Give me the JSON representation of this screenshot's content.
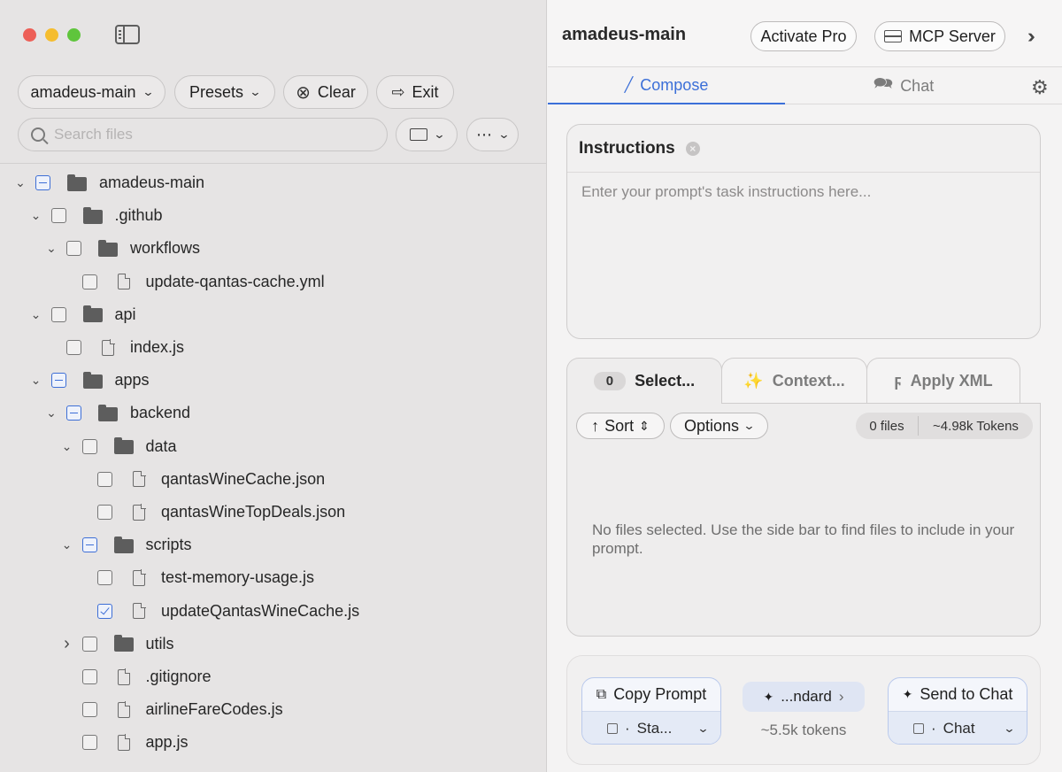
{
  "sidebar": {
    "project_select": "amadeus-main",
    "presets_label": "Presets",
    "clear_label": "Clear",
    "exit_label": "Exit",
    "search_placeholder": "Search files",
    "tree": [
      {
        "label": "amadeus-main",
        "type": "folder",
        "state": "mixed",
        "expand": "open"
      },
      {
        "label": ".github",
        "type": "folder",
        "state": "unchecked",
        "expand": "open"
      },
      {
        "label": "workflows",
        "type": "folder",
        "state": "unchecked",
        "expand": "open"
      },
      {
        "label": "update-qantas-cache.yml",
        "type": "file",
        "state": "unchecked",
        "expand": "none"
      },
      {
        "label": "api",
        "type": "folder",
        "state": "unchecked",
        "expand": "open"
      },
      {
        "label": "index.js",
        "type": "file",
        "state": "unchecked",
        "expand": "none"
      },
      {
        "label": "apps",
        "type": "folder",
        "state": "mixed",
        "expand": "open"
      },
      {
        "label": "backend",
        "type": "folder",
        "state": "mixed",
        "expand": "open"
      },
      {
        "label": "data",
        "type": "folder",
        "state": "unchecked",
        "expand": "open"
      },
      {
        "label": "qantasWineCache.json",
        "type": "file",
        "state": "unchecked",
        "expand": "none"
      },
      {
        "label": "qantasWineTopDeals.json",
        "type": "file",
        "state": "unchecked",
        "expand": "none"
      },
      {
        "label": "scripts",
        "type": "folder",
        "state": "mixed",
        "expand": "open"
      },
      {
        "label": "test-memory-usage.js",
        "type": "file",
        "state": "unchecked",
        "expand": "none"
      },
      {
        "label": "updateQantasWineCache.js",
        "type": "file",
        "state": "checked",
        "expand": "none"
      },
      {
        "label": "utils",
        "type": "folder",
        "state": "unchecked",
        "expand": "closed"
      },
      {
        "label": ".gitignore",
        "type": "file",
        "state": "unchecked",
        "expand": "none"
      },
      {
        "label": "airlineFareCodes.js",
        "type": "file",
        "state": "unchecked",
        "expand": "none"
      },
      {
        "label": "app.js",
        "type": "file",
        "state": "unchecked",
        "expand": "none"
      }
    ]
  },
  "header": {
    "title": "amadeus-main",
    "activate_label": "Activate Pro",
    "mcp_label": "MCP Server"
  },
  "tabs": {
    "compose": "Compose",
    "chat": "Chat"
  },
  "instructions": {
    "title": "Instructions",
    "placeholder": "Enter your prompt's task instructions here..."
  },
  "subtabs": {
    "selected_count": "0",
    "selected_label": "Select...",
    "context_label": "Context...",
    "apply_label": "Apply XML"
  },
  "files_panel": {
    "sort_label": "Sort",
    "options_label": "Options",
    "files_count": "0 files",
    "tokens": "~4.98k Tokens",
    "empty_message": "No files selected. Use the side bar to find files to include in your prompt."
  },
  "bottom": {
    "copy_label": "Copy Prompt",
    "copy_mode": "Sta...",
    "preset_chip": "...ndard",
    "token_estimate": "~5.5k tokens",
    "send_label": "Send to Chat",
    "send_mode": "Chat"
  },
  "colors": {
    "accent": "#3b6fd8",
    "close": "#ed5f57",
    "minimize": "#f5bd2f",
    "zoom": "#5fc53c"
  }
}
